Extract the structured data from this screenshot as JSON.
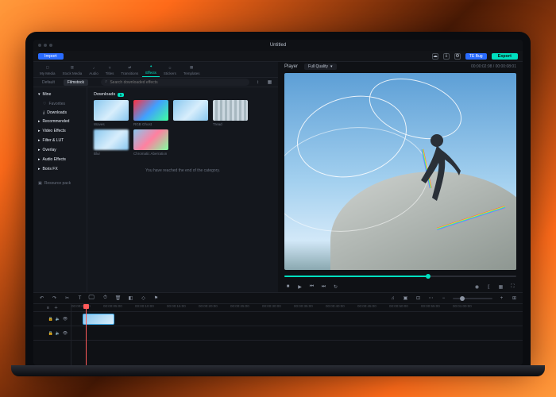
{
  "window": {
    "title": "Untitled"
  },
  "toolbar": {
    "import_label": "Import",
    "export_label": "Export",
    "bug_label": "TE Bug"
  },
  "tabs": [
    {
      "id": "my-media",
      "label": "My Media"
    },
    {
      "id": "stock-media",
      "label": "Stock Media"
    },
    {
      "id": "audio",
      "label": "Audio"
    },
    {
      "id": "titles",
      "label": "Titles"
    },
    {
      "id": "transitions",
      "label": "Transitions"
    },
    {
      "id": "effects",
      "label": "Effects",
      "active": true
    },
    {
      "id": "stickers",
      "label": "Stickers"
    },
    {
      "id": "templates",
      "label": "Templates"
    }
  ],
  "subtabs": [
    {
      "label": "Default"
    },
    {
      "label": "Filmstock",
      "active": true
    }
  ],
  "search": {
    "placeholder": "Search downloaded effects"
  },
  "sidebar": {
    "mine": {
      "label": "Mine",
      "items": [
        {
          "label": "Favorites"
        },
        {
          "label": "Downloads",
          "active": true
        }
      ]
    },
    "groups": [
      {
        "label": "Recommended"
      },
      {
        "label": "Video Effects"
      },
      {
        "label": "Filter & LUT"
      },
      {
        "label": "Overlay"
      },
      {
        "label": "Audio Effects"
      },
      {
        "label": "Boris FX"
      }
    ],
    "resource_pack": "Resource pack"
  },
  "gallery": {
    "heading": "Downloads",
    "badge": "5",
    "items": [
      {
        "label": "Waves"
      },
      {
        "label": "RGB Ghost"
      },
      {
        "label": ""
      },
      {
        "label": "Tread"
      },
      {
        "label": "Blur"
      },
      {
        "label": "Chromatic Aberration"
      }
    ],
    "end_message": "You have reached the end of the category."
  },
  "player": {
    "label": "Player",
    "quality": "Full Quality",
    "time_current": "00:00:02:08",
    "time_total": "00:00:08:01"
  },
  "timeline": {
    "marks": [
      "00:00:00:00",
      "00:00:05:00",
      "00:00:10:00",
      "00:00:15:00",
      "00:00:20:00",
      "00:00:25:00",
      "00:00:30:00",
      "00:00:35:00",
      "00:00:40:00",
      "00:00:45:00",
      "00:00:50:00",
      "00:00:55:00",
      "00:01:00:00"
    ]
  }
}
